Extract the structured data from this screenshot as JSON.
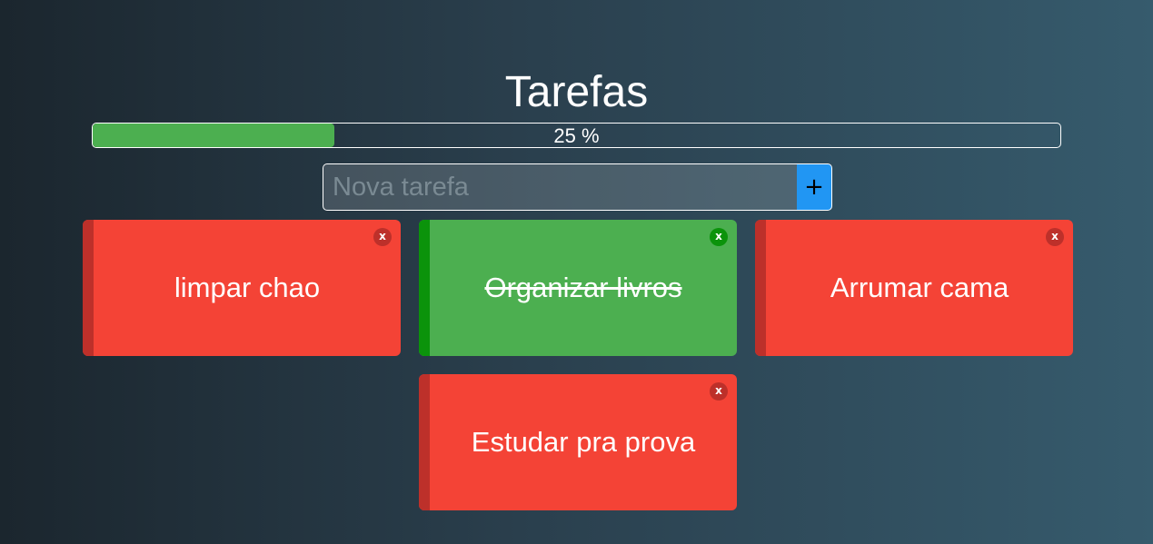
{
  "header": {
    "title": "Tarefas"
  },
  "progress": {
    "percent": 25,
    "label": "25 %"
  },
  "new_task": {
    "placeholder": "Nova tarefa",
    "value": "",
    "add_label": "+"
  },
  "tasks": [
    {
      "label": "limpar chao",
      "done": false,
      "delete_label": "x"
    },
    {
      "label": "Organizar livros",
      "done": true,
      "delete_label": "x"
    },
    {
      "label": "Arrumar cama",
      "done": false,
      "delete_label": "x"
    },
    {
      "label": "Estudar pra prova",
      "done": false,
      "delete_label": "x"
    }
  ],
  "colors": {
    "pending": "#f44336",
    "done": "#4caf50",
    "progress": "#4caf50",
    "add_button": "#2196f3"
  }
}
